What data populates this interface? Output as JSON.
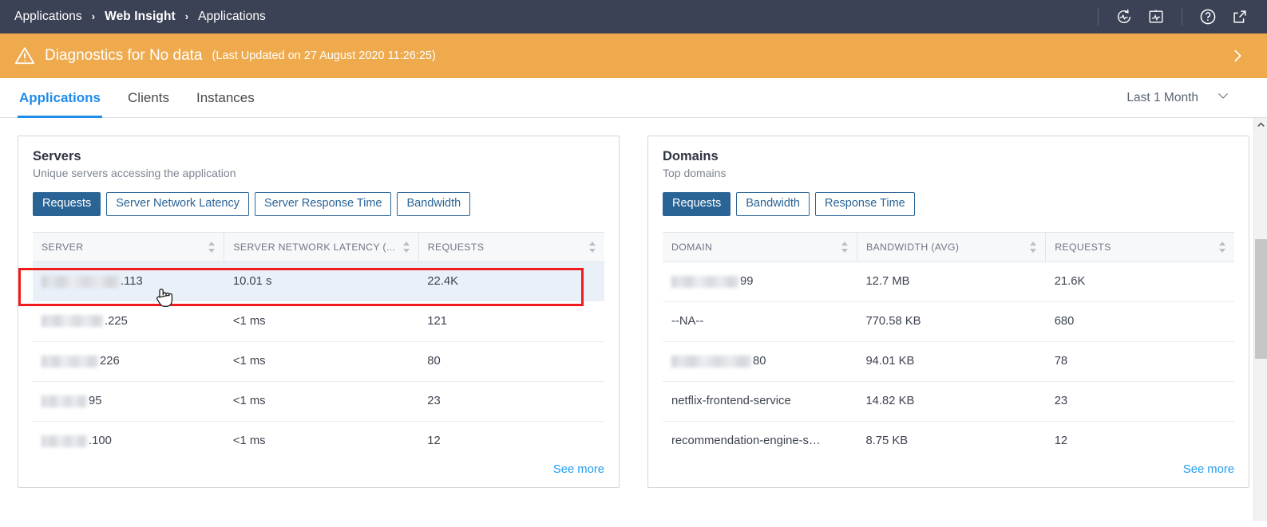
{
  "topbar": {
    "breadcrumb": [
      {
        "label": "Applications",
        "bold": false
      },
      {
        "label": "Web Insight",
        "bold": true
      },
      {
        "label": "Applications",
        "bold": false
      }
    ],
    "separator": "›",
    "icons": [
      "refresh-pulse-icon",
      "chart-box-icon",
      "help-icon",
      "external-link-icon"
    ]
  },
  "banner": {
    "icon": "warning-triangle-icon",
    "title": "Diagnostics for No data",
    "subtitle": "(Last Updated on 27 August 2020 11:26:25)",
    "expand_icon": "chevron-right-icon",
    "background": "#eeaa4d"
  },
  "tabs": [
    {
      "label": "Applications",
      "active": true
    },
    {
      "label": "Clients",
      "active": false
    },
    {
      "label": "Instances",
      "active": false
    }
  ],
  "time_range": {
    "label": "Last 1 Month",
    "icon": "chevron-down-icon"
  },
  "cards": [
    {
      "title": "Servers",
      "subtitle": "Unique servers accessing the application",
      "buttons": [
        {
          "label": "Requests",
          "active": true
        },
        {
          "label": "Server Network Latency",
          "active": false
        },
        {
          "label": "Server Response Time",
          "active": false
        },
        {
          "label": "Bandwidth",
          "active": false
        }
      ],
      "columns": [
        "SERVER",
        "SERVER NETWORK LATENCY (...",
        "REQUESTS"
      ],
      "rows": [
        {
          "redacted": true,
          "redact_width": 97,
          "name": ".113",
          "latency": "10.01 s",
          "requests": "22.4K",
          "highlighted": true
        },
        {
          "redacted": true,
          "redact_width": 77,
          "name": ".225",
          "latency": "<1 ms",
          "requests": "121",
          "highlighted": false
        },
        {
          "redacted": true,
          "redact_width": 71,
          "name": "226",
          "latency": "<1 ms",
          "requests": "80",
          "highlighted": false
        },
        {
          "redacted": true,
          "redact_width": 57,
          "name": "95",
          "latency": "<1 ms",
          "requests": "23",
          "highlighted": false
        },
        {
          "redacted": true,
          "redact_width": 57,
          "name": ".100",
          "latency": "<1 ms",
          "requests": "12",
          "highlighted": false
        }
      ],
      "see_more": "See more"
    },
    {
      "title": "Domains",
      "subtitle": "Top domains",
      "buttons": [
        {
          "label": "Requests",
          "active": true
        },
        {
          "label": "Bandwidth",
          "active": false
        },
        {
          "label": "Response Time",
          "active": false
        }
      ],
      "columns": [
        "DOMAIN",
        "BANDWIDTH (AVG)",
        "REQUESTS"
      ],
      "rows": [
        {
          "redacted": true,
          "redact_width": 84,
          "name": "99",
          "bandwidth": "12.7 MB",
          "requests": "21.6K"
        },
        {
          "redacted": false,
          "redact_width": 0,
          "name": "--NA--",
          "bandwidth": "770.58 KB",
          "requests": "680"
        },
        {
          "redacted": true,
          "redact_width": 100,
          "name": "80",
          "bandwidth": "94.01 KB",
          "requests": "78"
        },
        {
          "redacted": false,
          "redact_width": 0,
          "name": "netflix-frontend-service",
          "bandwidth": "14.82 KB",
          "requests": "23"
        },
        {
          "redacted": false,
          "redact_width": 0,
          "name": "recommendation-engine-s…",
          "bandwidth": "8.75 KB",
          "requests": "12"
        }
      ],
      "see_more": "See more"
    }
  ],
  "colors": {
    "header_bg": "#3c4255",
    "banner_bg": "#eeaa4d",
    "accent_blue": "#1f8ceb",
    "button_blue": "#2a6496",
    "link_blue": "#1f9cf0",
    "highlight_border": "#ee1c1c",
    "highlight_row_bg": "#e9f0f8"
  }
}
